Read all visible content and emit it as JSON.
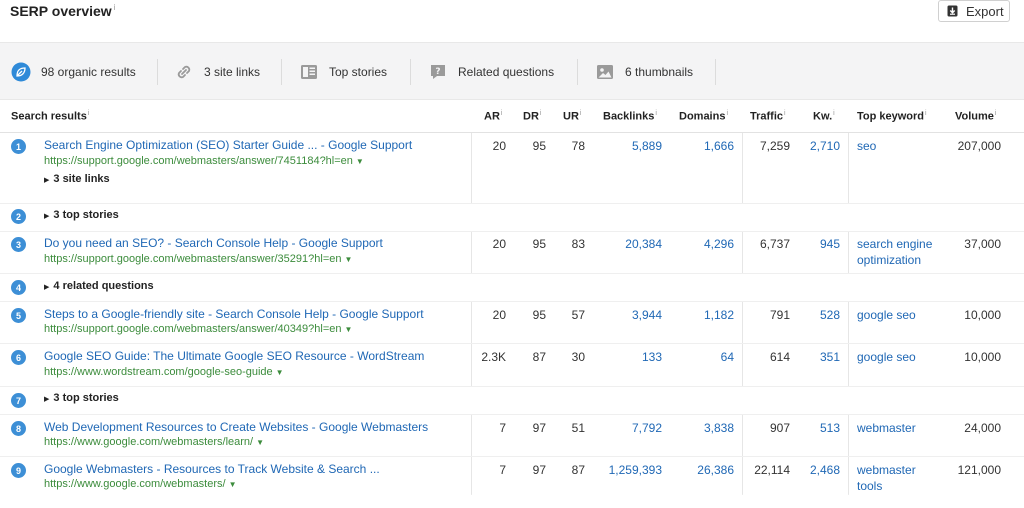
{
  "header": {
    "title": "SERP overview",
    "title_info": "i",
    "export_label": "Export"
  },
  "features": [
    {
      "icon": "leaf-icon",
      "label": "98 organic results"
    },
    {
      "icon": "link-icon",
      "label": "3 site links"
    },
    {
      "icon": "news-icon",
      "label": "Top stories"
    },
    {
      "icon": "question-icon",
      "label": "Related questions"
    },
    {
      "icon": "image-icon",
      "label": "6 thumbnails"
    }
  ],
  "columns": {
    "search_results": "Search results",
    "ar": "AR",
    "dr": "DR",
    "ur": "UR",
    "backlinks": "Backlinks",
    "domains": "Domains",
    "traffic": "Traffic",
    "kw": "Kw.",
    "top_keyword": "Top keyword",
    "volume": "Volume",
    "info": "i"
  },
  "rows": [
    {
      "n": "1",
      "title": "Search Engine Optimization (SEO) Starter Guide ... - Google Support",
      "url": "https://support.google.com/webmasters/answer/7451184?hl=en",
      "expander": "3 site links",
      "ar": "20",
      "dr": "95",
      "ur": "78",
      "backlinks": "5,889",
      "domains": "1,666",
      "traffic": "7,259",
      "kw": "2,710",
      "top_keyword": "seo",
      "volume": "207,000"
    },
    {
      "n": "2",
      "expander": "3 top stories"
    },
    {
      "n": "3",
      "title": "Do you need an SEO? - Search Console Help - Google Support",
      "url": "https://support.google.com/webmasters/answer/35291?hl=en",
      "ar": "20",
      "dr": "95",
      "ur": "83",
      "backlinks": "20,384",
      "domains": "4,296",
      "traffic": "6,737",
      "kw": "945",
      "top_keyword": "search engine optimization",
      "volume": "37,000"
    },
    {
      "n": "4",
      "expander": "4 related questions"
    },
    {
      "n": "5",
      "title": "Steps to a Google-friendly site - Search Console Help - Google Support",
      "url": "https://support.google.com/webmasters/answer/40349?hl=en",
      "ar": "20",
      "dr": "95",
      "ur": "57",
      "backlinks": "3,944",
      "domains": "1,182",
      "traffic": "791",
      "kw": "528",
      "top_keyword": "google seo",
      "volume": "10,000"
    },
    {
      "n": "6",
      "title": "Google SEO Guide: The Ultimate Google SEO Resource - WordStream",
      "url": "https://www.wordstream.com/google-seo-guide",
      "ar": "2.3K",
      "dr": "87",
      "ur": "30",
      "backlinks": "133",
      "domains": "64",
      "traffic": "614",
      "kw": "351",
      "top_keyword": "google seo",
      "volume": "10,000"
    },
    {
      "n": "7",
      "expander": "3 top stories"
    },
    {
      "n": "8",
      "title": "Web Development Resources to Create Websites - Google Webmasters",
      "url": "https://www.google.com/webmasters/learn/",
      "ar": "7",
      "dr": "97",
      "ur": "51",
      "backlinks": "7,792",
      "domains": "3,838",
      "traffic": "907",
      "kw": "513",
      "top_keyword": "webmaster",
      "volume": "24,000"
    },
    {
      "n": "9",
      "title": "Google Webmasters - Resources to Track Website & Search ...",
      "url": "https://www.google.com/webmasters/",
      "ar": "7",
      "dr": "97",
      "ur": "87",
      "backlinks": "1,259,393",
      "domains": "26,386",
      "traffic": "22,114",
      "kw": "2,468",
      "top_keyword": "webmaster tools",
      "volume": "121,000"
    }
  ],
  "colors": {
    "accent": "#2068b5",
    "url_green": "#3c8c3c",
    "badge": "#3d8fd6",
    "bar_bg": "#f4f4f5"
  }
}
